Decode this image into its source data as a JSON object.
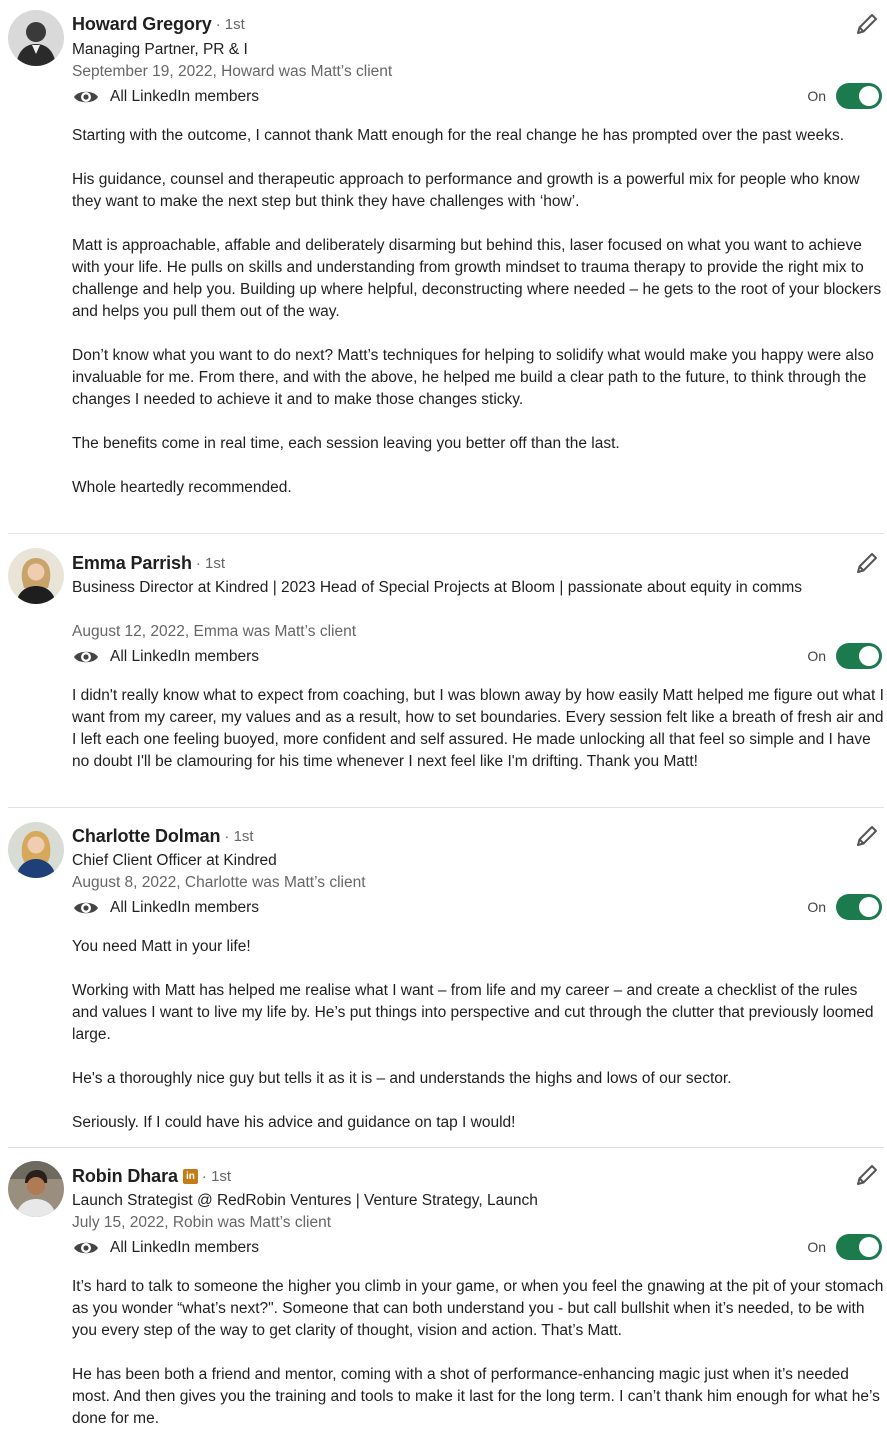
{
  "recommendations": [
    {
      "name": "Howard Gregory",
      "degree": "· 1st",
      "headline": "Managing Partner, PR & I",
      "meta": "September 19, 2022, Howard was Matt’s client",
      "visibility": "All LinkedIn members",
      "toggle_label": "On",
      "paragraphs": [
        "Starting with the outcome, I cannot thank Matt enough for the real change he has prompted over the past weeks.",
        "His guidance, counsel and therapeutic approach to performance and growth is a powerful mix for people who know they want to make the next step but think they have challenges with ‘how’.",
        "Matt is approachable, affable and deliberately disarming but behind this, laser focused on what you want to achieve with your life. He pulls on skills and understanding from growth mindset to trauma therapy to provide the right mix to challenge and help you. Building up where helpful, deconstructing where needed – he gets to the root of your blockers and helps you pull them out of the way.",
        "Don’t know what you want to do next? Matt’s techniques for helping to solidify what would make you happy were also invaluable for me. From there, and with the above, he helped me build a clear path to the future, to think through the changes I needed to achieve it and to make those changes sticky.",
        "The benefits come in real time, each session leaving you better off than the last.",
        "Whole heartedly recommended."
      ]
    },
    {
      "name": "Emma Parrish",
      "degree": "· 1st",
      "headline": "Business Director at Kindred | 2023 Head of Special Projects at Bloom | passionate about equity in comms",
      "meta": "August 12, 2022, Emma was Matt’s client",
      "visibility": "All LinkedIn members",
      "toggle_label": "On",
      "paragraphs": [
        "I didn't really know what to expect from coaching, but I was blown away by how easily Matt helped me figure out what I want from my career, my values and as a result, how to set boundaries. Every session felt like a breath of fresh air and I left each one feeling buoyed, more confident and self assured. He made unlocking all that feel so simple and I have no doubt I'll be clamouring for his time whenever I next feel like I'm drifting. Thank you Matt!"
      ]
    },
    {
      "name": "Charlotte Dolman",
      "degree": "· 1st",
      "headline": "Chief Client Officer at Kindred",
      "meta": "August 8, 2022, Charlotte was Matt’s client",
      "visibility": "All LinkedIn members",
      "toggle_label": "On",
      "paragraphs": [
        "You need Matt in your life!",
        "Working with Matt has helped me realise what I want – from life and my career – and create a checklist of the rules and values I want to live my life by. He’s put things into perspective and cut through the clutter that previously loomed large.",
        "He's a thoroughly nice guy but tells it as it is – and understands the highs and lows of our sector.",
        "Seriously. If I could have his advice and guidance on tap I would!"
      ]
    },
    {
      "name": "Robin Dhara",
      "badge": "in",
      "degree": "· 1st",
      "headline": "Launch Strategist @ RedRobin Ventures | Venture Strategy, Launch",
      "meta": "July 15, 2022, Robin was Matt’s client",
      "visibility": "All LinkedIn members",
      "toggle_label": "On",
      "paragraphs": [
        "It’s hard to talk to someone the higher you climb in your game, or when you feel the gnawing at the pit of your stomach as you wonder “what’s next?\". Someone that can both understand you - but call bullshit when it’s needed, to be with you every step of the way to get clarity of thought, vision and action. That’s Matt.",
        "He has been both a friend and mentor, coming with a shot of performance-enhancing magic just when it’s needed most. And then gives you the training and tools to make it last for the long term. I can’t thank him enough for what he’s done for me."
      ]
    }
  ]
}
